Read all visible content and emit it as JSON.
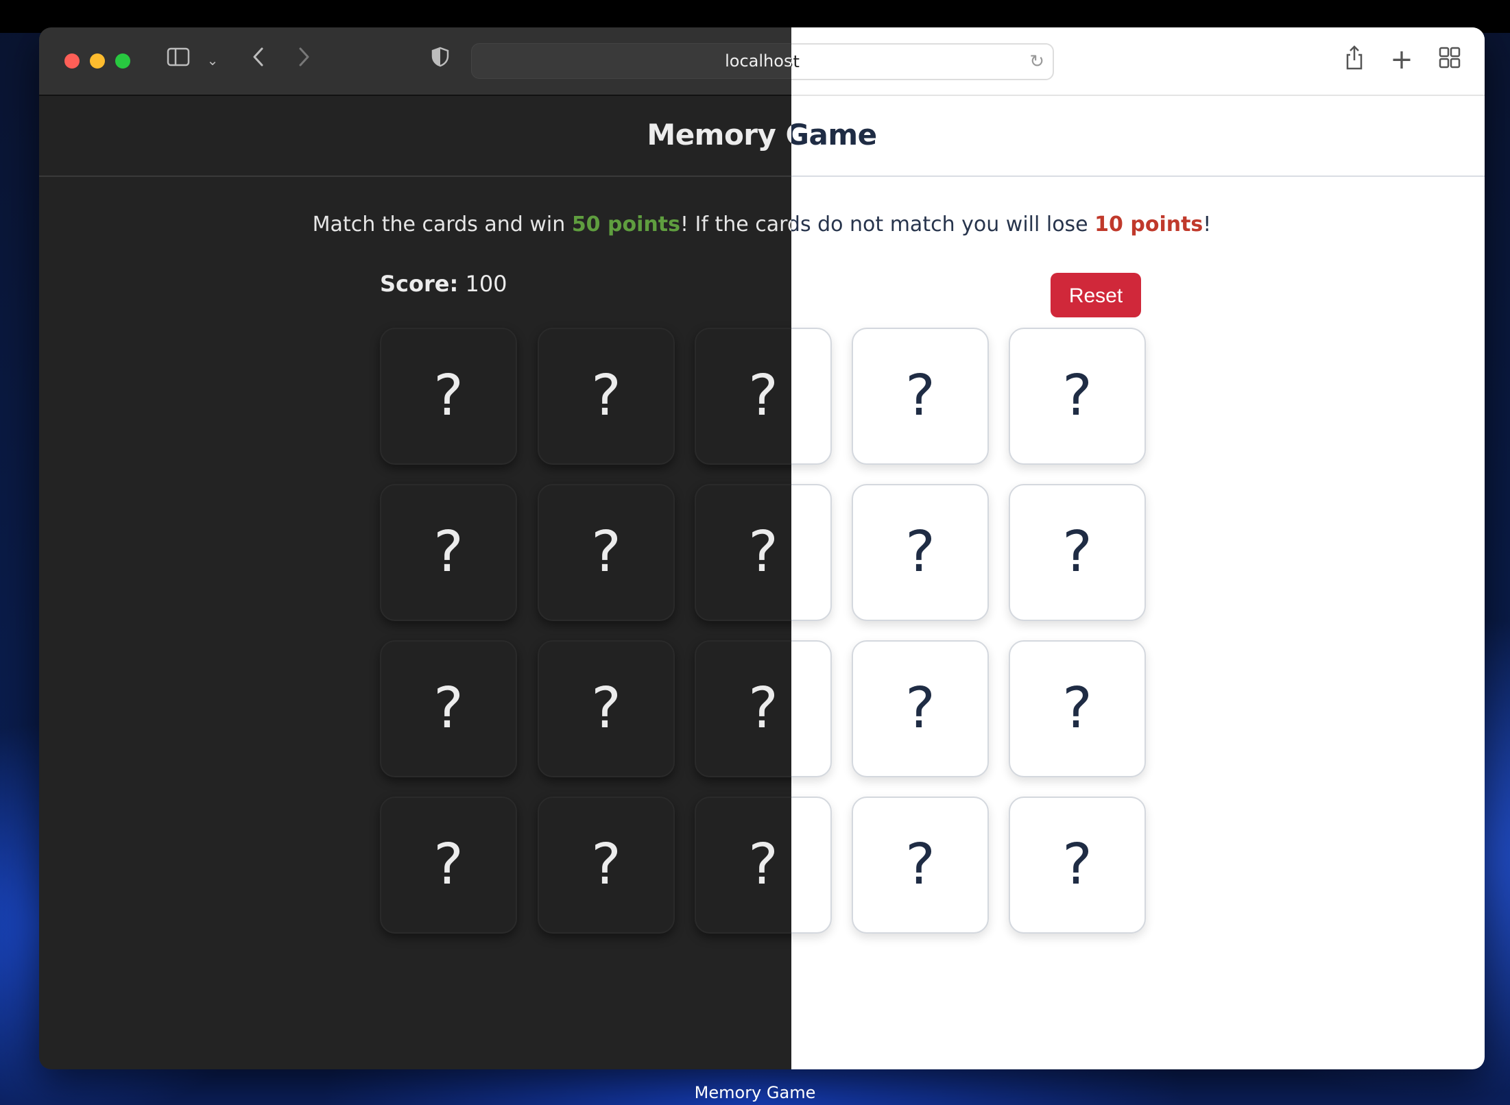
{
  "browser": {
    "url": "localhost",
    "icons": [
      "sidebar-icon",
      "chevron-down-icon",
      "back-icon",
      "forward-icon",
      "shield-icon",
      "reload-icon",
      "share-icon",
      "new-tab-icon",
      "tab-overview-icon"
    ]
  },
  "page": {
    "title": "Memory Game",
    "instructions": {
      "part1": "Match the cards and win ",
      "win_points": "50 points",
      "part2": "! If the cards do not match you will lose ",
      "lose_points": "10 points",
      "part3": "!"
    },
    "score_label": "Score:",
    "score_value": "100",
    "reset_label": "Reset",
    "cards": [
      {
        "face": "?"
      },
      {
        "face": "?"
      },
      {
        "face": "?"
      },
      {
        "face": "?"
      },
      {
        "face": "?"
      },
      {
        "face": "?"
      },
      {
        "face": "?"
      },
      {
        "face": "?"
      },
      {
        "face": "?"
      },
      {
        "face": "?"
      },
      {
        "face": "?"
      },
      {
        "face": "?"
      },
      {
        "face": "?"
      },
      {
        "face": "?"
      },
      {
        "face": "?"
      },
      {
        "face": "?"
      },
      {
        "face": "?"
      },
      {
        "face": "?"
      },
      {
        "face": "?"
      },
      {
        "face": "?"
      }
    ],
    "colors": {
      "win": "#5f9e3f",
      "lose": "#c0392b",
      "reset": "#d0283a"
    }
  },
  "dock": {
    "app_label": "Memory Game"
  }
}
